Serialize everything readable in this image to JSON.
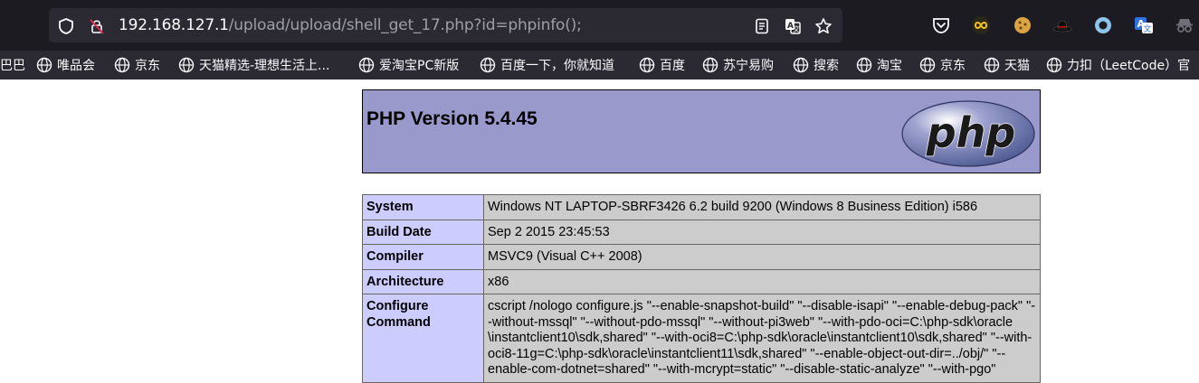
{
  "browser": {
    "url_host": "192.168.127.1",
    "url_path": "/upload/upload/shell_get_17.php?id=phpinfo();",
    "bookmarks": [
      {
        "label": "巴巴"
      },
      {
        "label": "唯品会"
      },
      {
        "label": "京东"
      },
      {
        "label": "天猫精选-理想生活上..."
      },
      {
        "label": "爱淘宝PC新版"
      },
      {
        "label": "百度一下，你就知道"
      },
      {
        "label": "百度"
      },
      {
        "label": "苏宁易购"
      },
      {
        "label": "搜索"
      },
      {
        "label": "淘宝"
      },
      {
        "label": "京东"
      },
      {
        "label": "天猫"
      },
      {
        "label": "力扣（LeetCode）官"
      }
    ]
  },
  "page": {
    "title": "PHP Version 5.4.45",
    "logo_text": "php",
    "rows": [
      {
        "key": "System",
        "value": "Windows NT LAPTOP-SBRF3426 6.2 build 9200 (Windows 8 Business Edition) i586"
      },
      {
        "key": "Build Date",
        "value": "Sep 2 2015 23:45:53"
      },
      {
        "key": "Compiler",
        "value": "MSVC9 (Visual C++ 2008)"
      },
      {
        "key": "Architecture",
        "value": "x86"
      },
      {
        "key": "Configure Command",
        "value": "cscript /nologo configure.js \"--enable-snapshot-build\" \"--disable-isapi\" \"--enable-debug-pack\" \"--without-mssql\" \"--without-pdo-mssql\" \"--without-pi3web\" \"--with-pdo-oci=C:\\php-sdk\\oracle \\instantclient10\\sdk,shared\" \"--with-oci8=C:\\php-sdk\\oracle\\instantclient10\\sdk,shared\" \"--with-oci8-11g=C:\\php-sdk\\oracle\\instantclient11\\sdk,shared\" \"--enable-object-out-dir=../obj/\" \"--enable-com-dotnet=shared\" \"--with-mcrypt=static\" \"--disable-static-analyze\" \"--with-pgo\""
      }
    ]
  },
  "colors": {
    "header_bg": "#9999cc",
    "key_bg": "#ccccff",
    "value_bg": "#cccccc",
    "chrome_bg": "#1c1b22",
    "bookmarks_bg": "#2b2a33"
  }
}
